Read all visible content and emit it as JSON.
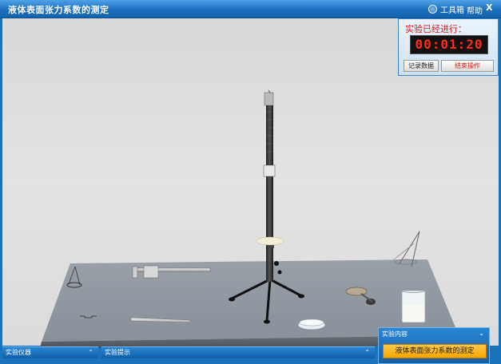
{
  "window": {
    "title": "液体表面张力系数的测定"
  },
  "toolbar": {
    "toolbox_label": "工具箱",
    "help_label": "帮助",
    "close_label": "X"
  },
  "timer": {
    "label": "实验已经进行：",
    "display": "00:01:20"
  },
  "actions": {
    "record_label": "记录数据",
    "end_label": "结束操作"
  },
  "bottom": {
    "instruments_label": "实验仪器",
    "tips_label": "实验提示",
    "content_label": "实验内容",
    "content_item": "液体表面张力系数的测定"
  },
  "icons": [
    "toolbox-icon",
    "expand-chevron-icon",
    "collapse-chevron-icon"
  ]
}
